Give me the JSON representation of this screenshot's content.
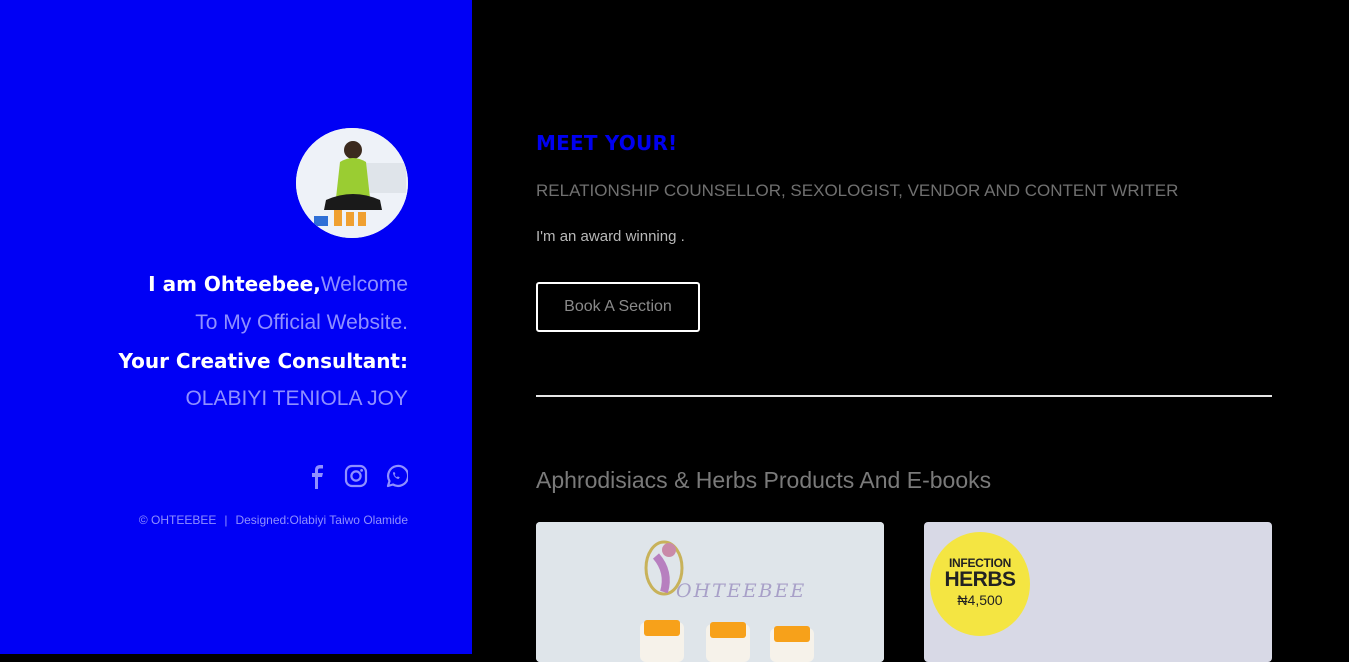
{
  "sidebar": {
    "avatar_alt": "profile photo",
    "intro": {
      "name_line": "I am Ohteebee,",
      "welcome": "Welcome",
      "website_line": "To My Official Website.",
      "consultant_line": "Your Creative Consultant:",
      "full_name": "OLABIYI TENIOLA JOY"
    },
    "social": [
      {
        "icon": "facebook-icon"
      },
      {
        "icon": "instagram-icon"
      },
      {
        "icon": "whatsapp-icon"
      }
    ],
    "footer": {
      "copyright": "© OHTEEBEE",
      "separator": "|",
      "designer": "Designed:Olabiyi Taiwo Olamide"
    }
  },
  "main": {
    "eyebrow": "MEET YOUR!",
    "roles": "RELATIONSHIP COUNSELLOR, SEXOLOGIST, VENDOR AND CONTENT WRITER",
    "tagline": "I'm an award winning .",
    "cta_label": "Book A Section",
    "products_title": "Aphrodisiacs & Herbs Products And E-books",
    "products": [
      {
        "logo_text": "OHTEEBEE"
      },
      {
        "badge_line1": "INFECTION",
        "badge_line2": "HERBS",
        "badge_price": "₦4,500"
      }
    ]
  },
  "colors": {
    "sidebar_bg": "#0000f5",
    "accent": "#0000f0",
    "main_bg": "#000000"
  }
}
